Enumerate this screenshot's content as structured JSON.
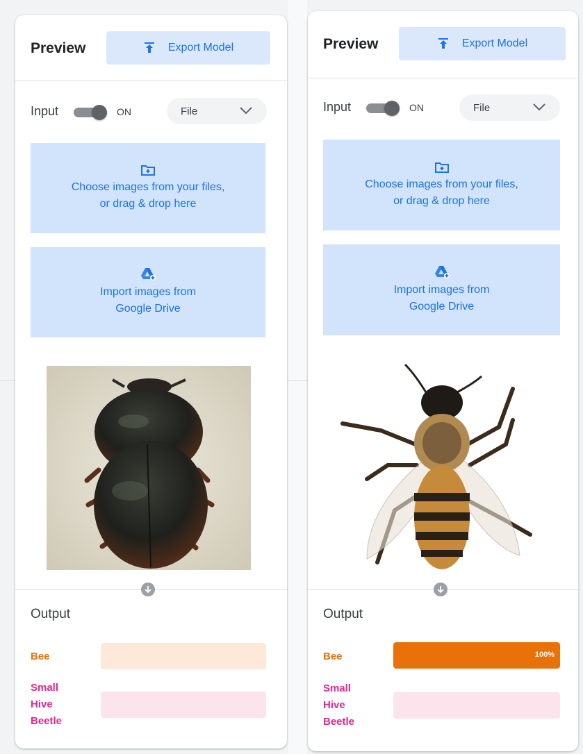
{
  "colors": {
    "accent": "#1a73e8",
    "button_bg": "#dbe8fc",
    "drop_bg": "#d2e3fc",
    "bee": "#e8710a",
    "bee_track": "#fde8da",
    "beetle": "#e52592",
    "beetle_track": "#fce4ec"
  },
  "panels": [
    {
      "header": {
        "title": "Preview",
        "export_label": "Export Model",
        "export_icon": "upload-icon"
      },
      "input": {
        "label": "Input",
        "toggle_state": "ON",
        "source_select": "File"
      },
      "upload": {
        "line1": "Choose images from your files,",
        "line2": "or drag & drop here",
        "icon": "folder-add-icon"
      },
      "drive": {
        "line1": "Import images from",
        "line2": "Google Drive",
        "icon": "google-drive-icon"
      },
      "image": "small-hive-beetle-photo",
      "output": {
        "label": "Output",
        "classes": [
          {
            "line1": "Bee",
            "line2": "",
            "line3": "",
            "confidence": 0,
            "percent_text": ""
          },
          {
            "line1": "Small",
            "line2": "Hive",
            "line3": "Beetle",
            "confidence": 0,
            "percent_text": ""
          }
        ]
      }
    },
    {
      "header": {
        "title": "Preview",
        "export_label": "Export Model",
        "export_icon": "upload-icon"
      },
      "input": {
        "label": "Input",
        "toggle_state": "ON",
        "source_select": "File"
      },
      "upload": {
        "line1": "Choose images from your files,",
        "line2": "or drag & drop here",
        "icon": "folder-add-icon"
      },
      "drive": {
        "line1": "Import images from",
        "line2": "Google Drive",
        "icon": "google-drive-icon"
      },
      "image": "honey-bee-photo",
      "output": {
        "label": "Output",
        "classes": [
          {
            "line1": "Bee",
            "line2": "",
            "line3": "",
            "confidence": 1.0,
            "percent_text": "100%"
          },
          {
            "line1": "Small",
            "line2": "Hive",
            "line3": "Beetle",
            "confidence": 0,
            "percent_text": ""
          }
        ]
      }
    }
  ]
}
